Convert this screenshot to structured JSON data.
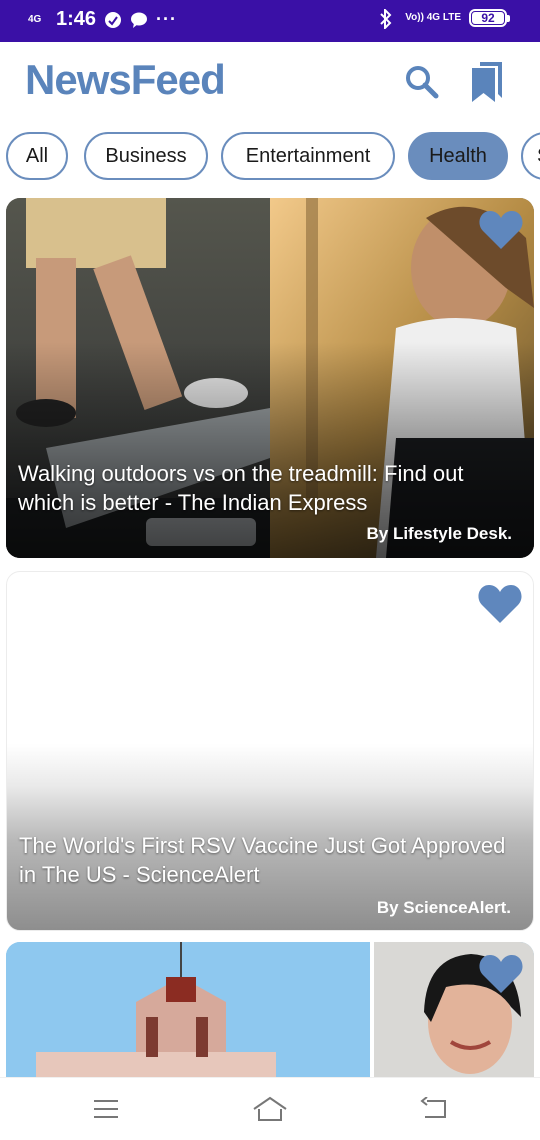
{
  "status_bar": {
    "network": "4G",
    "time": "1:46",
    "volte": "Vo)) 4G LTE",
    "battery": "92"
  },
  "app_bar": {
    "title": "NewsFeed",
    "search_icon": "search-icon",
    "bookmark_icon": "bookmark-icon"
  },
  "categories": [
    {
      "label": "All",
      "active": false
    },
    {
      "label": "Business",
      "active": false
    },
    {
      "label": "Entertainment",
      "active": false
    },
    {
      "label": "Health",
      "active": true
    },
    {
      "label": "S",
      "active": false
    }
  ],
  "articles": [
    {
      "title": "Walking outdoors vs on the treadmill: Find out which is better - The Indian Express",
      "author": "By Lifestyle Desk.",
      "favorite_icon": "heart-icon"
    },
    {
      "title": "The World's First RSV Vaccine Just Got Approved in The US - ScienceAlert",
      "author": "By ScienceAlert.",
      "favorite_icon": "heart-icon"
    },
    {
      "title": "",
      "author": "",
      "favorite_icon": "heart-icon"
    }
  ],
  "colors": {
    "status_bar": "#3a10a6",
    "accent": "#5a84bb",
    "chip_border": "#6a8dbd",
    "heart": "#5f87bd"
  },
  "nav_bar": {
    "menu_icon": "menu-icon",
    "home_icon": "home-icon",
    "back_icon": "back-icon"
  }
}
